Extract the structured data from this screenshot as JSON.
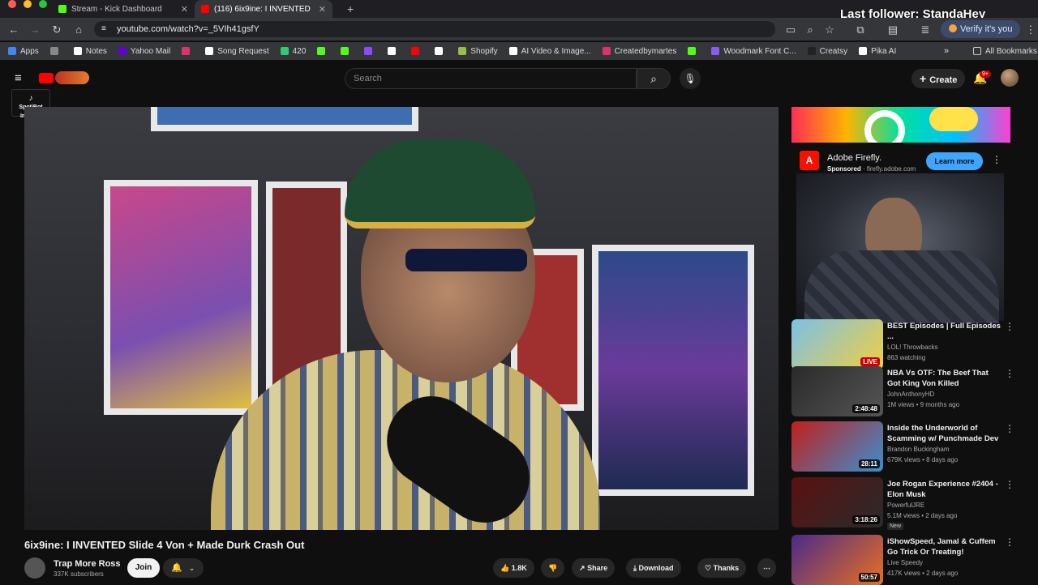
{
  "tabs": [
    {
      "title": "Stream - Kick Dashboard",
      "active": false
    },
    {
      "title": "(116) 6ix9ine: I INVENTED",
      "active": true
    }
  ],
  "overlay": {
    "last_follower": "Last follower: StandaHey"
  },
  "address": {
    "url": "youtube.com/watch?v=_5VIh41gsfY",
    "verify_label": "Verify it's you"
  },
  "bookmarks": [
    {
      "label": "Apps",
      "color": "#4285f4"
    },
    {
      "label": "",
      "color": "#888888"
    },
    {
      "label": "Notes",
      "color": "#ffffff"
    },
    {
      "label": "Yahoo Mail",
      "color": "#6001d2"
    },
    {
      "label": "",
      "color": "#e1306c"
    },
    {
      "label": "Song Request",
      "color": "#ffffff"
    },
    {
      "label": "420",
      "color": "#2ecc71"
    },
    {
      "label": "",
      "color": "#53fc18"
    },
    {
      "label": "",
      "color": "#53fc18"
    },
    {
      "label": "",
      "color": "#9146ff"
    },
    {
      "label": "",
      "color": "#ffffff"
    },
    {
      "label": "",
      "color": "#ff0000"
    },
    {
      "label": "",
      "color": "#ffffff"
    },
    {
      "label": "Shopify",
      "color": "#95bf47"
    },
    {
      "label": "AI Video & Image...",
      "color": "#ffffff"
    },
    {
      "label": "Createdbymartes",
      "color": "#e1306c"
    },
    {
      "label": "",
      "color": "#53fc18"
    },
    {
      "label": "Woodmark Font C...",
      "color": "#8a5cf6"
    },
    {
      "label": "Creatsy",
      "color": "#222222"
    },
    {
      "label": "Pika AI",
      "color": "#ffffff"
    }
  ],
  "all_bookmarks": "All Bookmarks",
  "youtube": {
    "search_placeholder": "Search",
    "create_label": "Create",
    "notif_count": "9+",
    "spotibot": "SpotiBot Inactive"
  },
  "video": {
    "title": "6ix9ine: I INVENTED Slide 4 Von + Made Durk Crash Out",
    "channel": "Trap More Ross",
    "subscribers": "337K subscribers",
    "join_label": "Join",
    "likes": "1.8K",
    "share_label": "Share",
    "download_label": "Download",
    "thanks_label": "Thanks"
  },
  "ad": {
    "brand": "Adobe Firefly.",
    "sponsored": "Sponsored",
    "domain": "firefly.adobe.com",
    "cta": "Learn more"
  },
  "recommendations": [
    {
      "title": "BEST Episodes | Full Episodes ...",
      "channel": "LOL! Throwbacks",
      "meta": "863 watching",
      "duration": "LIVE",
      "live": true,
      "colors": [
        "#7bc0e8",
        "#f0d040"
      ]
    },
    {
      "title": "NBA Vs OTF: The Beef That Got King Von Killed",
      "channel": "JohnAnthonyHD",
      "meta": "1M views • 9 months ago",
      "duration": "2:48:48",
      "live": false,
      "colors": [
        "#2a2a2a",
        "#555555"
      ]
    },
    {
      "title": "Inside the Underworld of Scamming w/ Punchmade Dev",
      "channel": "Brandon Buckingham",
      "meta": "679K views • 8 days ago",
      "duration": "28:11",
      "live": false,
      "colors": [
        "#c0201a",
        "#3a8fd0"
      ]
    },
    {
      "title": "Joe Rogan Experience #2404 - Elon Musk",
      "channel": "PowerfulJRE",
      "meta": "5.1M views • 2 days ago",
      "duration": "3:18:26",
      "live": false,
      "badge": "New",
      "colors": [
        "#5a1010",
        "#2b2b2b"
      ]
    },
    {
      "title": "iShowSpeed, Jamal & Cuffem Go Trick Or Treating!",
      "channel": "Live Speedy",
      "meta": "417K views • 2 days ago",
      "duration": "50:57",
      "live": false,
      "colors": [
        "#4a2a8a",
        "#e87020"
      ]
    }
  ]
}
